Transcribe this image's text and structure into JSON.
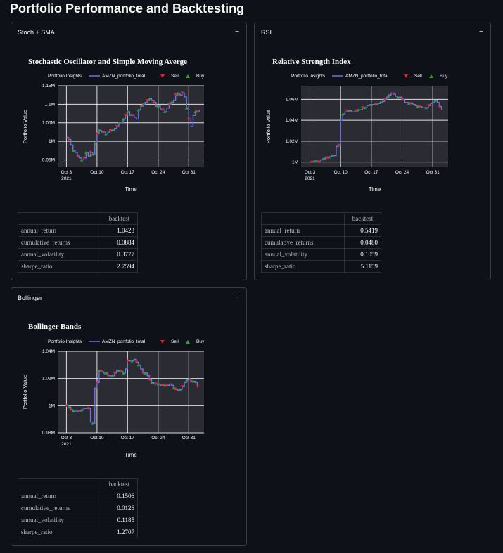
{
  "page": {
    "title": "Portfolio Performance and Backtesting"
  },
  "legend": {
    "label": "Portfolio Insights",
    "series": "AMZN_portfolio_total",
    "sell": "Sell",
    "buy": "Buy"
  },
  "colors": {
    "line": "#6b73e6",
    "sell": "#e0242a",
    "buy": "#2aa12a",
    "bg": "#0e1117",
    "plot_bg": "#2a2b33"
  },
  "panels": {
    "stoch": {
      "header": "Stoch + SMA",
      "collapse": "−",
      "chart_title": "Stochastic Oscillator and Simple Moving Averge",
      "table": {
        "col": "backtest",
        "rows": [
          {
            "key": "annual_return",
            "val": "1.0423"
          },
          {
            "key": "cumulative_returns",
            "val": "0.0884"
          },
          {
            "key": "annual_volatility",
            "val": "0.3777"
          },
          {
            "key": "sharpe_ratio",
            "val": "2.7594"
          }
        ]
      }
    },
    "rsi": {
      "header": "RSI",
      "collapse": "−",
      "chart_title": "Relative Strength Index",
      "table": {
        "col": "backtest",
        "rows": [
          {
            "key": "annual_return",
            "val": "0.5419"
          },
          {
            "key": "cumulative_returns",
            "val": "0.0480"
          },
          {
            "key": "annual_volatility",
            "val": "0.1059"
          },
          {
            "key": "sharpe_ratio",
            "val": "5.1159"
          }
        ]
      }
    },
    "bollinger": {
      "header": "Bollinger",
      "collapse": "−",
      "chart_title": "Bollinger Bands",
      "table": {
        "col": "backtest",
        "rows": [
          {
            "key": "annual_return",
            "val": "0.1506"
          },
          {
            "key": "cumulative_returns",
            "val": "0.0126"
          },
          {
            "key": "annual_volatility",
            "val": "0.1185"
          },
          {
            "key": "sharpe_ratio",
            "val": "1.2707"
          }
        ]
      }
    }
  },
  "chart_data": [
    {
      "type": "line",
      "title": "Stochastic Oscillator and Simple Moving Averge",
      "xlabel": "Time",
      "ylabel": "Portfolio Value",
      "x_ticks": [
        "Oct 3",
        "Oct 10",
        "Oct 17",
        "Oct 24",
        "Oct 31"
      ],
      "x_tick_sub": "2021",
      "y_ticks": [
        "0.95M",
        "1M",
        "1.05M",
        "1.1M",
        "1.15M"
      ],
      "xlim": [
        -2,
        31.5
      ],
      "ylim": [
        0.93,
        1.15
      ],
      "grid": true,
      "legend": "top",
      "series": [
        {
          "name": "AMZN_portfolio_total",
          "x": [
            0,
            0.5,
            1,
            1.5,
            2,
            2.5,
            3,
            3.5,
            4,
            4.5,
            5,
            5.5,
            6,
            6.5,
            7,
            7.5,
            8,
            8.5,
            9,
            9.5,
            10,
            10.5,
            11,
            11.5,
            12,
            12.5,
            13,
            13.5,
            14,
            14.5,
            15,
            15.5,
            16,
            16.5,
            17,
            17.5,
            18,
            18.5,
            19,
            19.5,
            20,
            20.5,
            21,
            21.5,
            22,
            22.5,
            23,
            23.5,
            24,
            24.5,
            25,
            25.5,
            26,
            26.5,
            27,
            27.5,
            28,
            28.5,
            29,
            29.5,
            30,
            30.5
          ],
          "y": [
            1.01,
            1.005,
            0.99,
            0.975,
            0.97,
            0.96,
            0.955,
            0.95,
            0.955,
            0.97,
            0.96,
            0.97,
            0.965,
            0.995,
            1.02,
            1.03,
            1.025,
            1.025,
            1.02,
            1.025,
            1.03,
            1.03,
            1.035,
            1.04,
            1.05,
            1.05,
            1.06,
            1.07,
            1.08,
            1.07,
            1.07,
            1.065,
            1.06,
            1.085,
            1.095,
            1.1,
            1.105,
            1.11,
            1.115,
            1.11,
            1.105,
            1.095,
            1.095,
            1.085,
            1.085,
            1.08,
            1.09,
            1.1,
            1.105,
            1.11,
            1.125,
            1.13,
            1.125,
            1.13,
            1.12,
            1.09,
            1.06,
            1.04,
            1.07,
            1.08,
            1.08,
            1.085
          ]
        }
      ],
      "buys_x": [
        1.5,
        3.5,
        4.5,
        6,
        6.5,
        7.5,
        9,
        10.5,
        12,
        13,
        14,
        16.5,
        17.5,
        19,
        21,
        22.5,
        24,
        25.5,
        27.5,
        29.5
      ],
      "sells_x": [
        0.5,
        2.5,
        4,
        5.5,
        7,
        8.5,
        10,
        11.5,
        13.5,
        15,
        17,
        18.5,
        20,
        22,
        23.5,
        25,
        26.5,
        28,
        30
      ]
    },
    {
      "type": "line",
      "title": "Relative Strength Index",
      "xlabel": "Time",
      "ylabel": "Portfolio Value",
      "x_ticks": [
        "Oct 3",
        "Oct 10",
        "Oct 17",
        "Oct 24",
        "Oct 31"
      ],
      "x_tick_sub": "2021",
      "y_ticks": [
        "1M",
        "1.02M",
        "1.04M",
        "1.06M"
      ],
      "xlim": [
        -2,
        31.5
      ],
      "ylim": [
        0.995,
        1.073
      ],
      "grid": true,
      "legend": "top",
      "series": [
        {
          "name": "AMZN_portfolio_total",
          "x": [
            0,
            0.5,
            1,
            1.5,
            2,
            2.5,
            3,
            3.5,
            4,
            4.5,
            5,
            5.5,
            6,
            6.5,
            7,
            7.5,
            8,
            8.5,
            9,
            9.5,
            10,
            10.5,
            11,
            11.5,
            12,
            12.5,
            13,
            13.5,
            14,
            14.5,
            15,
            15.5,
            16,
            16.5,
            17,
            17.5,
            18,
            18.5,
            19,
            19.5,
            20,
            20.5,
            21,
            21.5,
            22,
            22.5,
            23,
            23.5,
            24,
            24.5,
            25,
            25.5,
            26,
            26.5,
            27,
            27.5,
            28,
            28.5,
            29,
            29.5,
            30
          ],
          "y": [
            1.0,
            1.0,
            1.001,
            1.001,
            1.0,
            1.002,
            1.003,
            1.004,
            1.004,
            1.005,
            1.006,
            1.006,
            1.015,
            1.016,
            1.04,
            1.046,
            1.048,
            1.049,
            1.049,
            1.048,
            1.048,
            1.049,
            1.05,
            1.05,
            1.052,
            1.052,
            1.054,
            1.055,
            1.055,
            1.055,
            1.055,
            1.056,
            1.057,
            1.058,
            1.06,
            1.062,
            1.064,
            1.066,
            1.065,
            1.063,
            1.062,
            1.062,
            1.06,
            1.057,
            1.057,
            1.056,
            1.056,
            1.055,
            1.054,
            1.053,
            1.053,
            1.052,
            1.052,
            1.052,
            1.054,
            1.056,
            1.057,
            1.059,
            1.057,
            1.053,
            1.05
          ]
        }
      ],
      "buys_x": [
        1,
        3,
        5,
        7.5,
        9,
        11,
        12.5,
        14,
        16,
        18,
        20,
        22.5,
        24.5,
        26.5,
        28.5
      ],
      "sells_x": [
        0.5,
        2,
        4,
        6.5,
        8.5,
        10.5,
        12,
        15,
        17,
        19,
        21,
        23,
        25,
        27,
        29.5
      ]
    },
    {
      "type": "line",
      "title": "Bollinger Bands",
      "xlabel": "Time",
      "ylabel": "Portfolio Value",
      "x_ticks": [
        "Oct 3",
        "Oct 10",
        "Oct 17",
        "Oct 24",
        "Oct 31"
      ],
      "x_tick_sub": "2021",
      "y_ticks": [
        "0.98M",
        "1M",
        "1.02M",
        "1.04M"
      ],
      "xlim": [
        -2,
        31.5
      ],
      "ylim": [
        0.98,
        1.04
      ],
      "grid": true,
      "legend": "top",
      "series": [
        {
          "name": "AMZN_portfolio_total",
          "x": [
            0,
            0.5,
            1,
            1.5,
            2,
            2.5,
            3,
            3.5,
            4,
            4.5,
            5,
            5.5,
            6,
            6.5,
            7,
            7.5,
            8,
            8.5,
            9,
            9.5,
            10,
            10.5,
            11,
            11.5,
            12,
            12.5,
            13,
            13.5,
            14,
            14.5,
            15,
            15.5,
            16,
            16.5,
            17,
            17.5,
            18,
            18.5,
            19,
            19.5,
            20,
            20.5,
            21,
            21.5,
            22,
            22.5,
            23,
            23.5,
            24,
            24.5,
            25,
            25.5,
            26,
            26.5,
            27,
            27.5,
            28,
            28.5,
            29,
            29.5,
            30
          ],
          "y": [
            1.0,
            0.999,
            0.997,
            0.996,
            0.996,
            0.996,
            0.996,
            0.997,
            0.998,
            0.998,
            0.998,
            0.988,
            0.987,
            1.013,
            1.017,
            1.026,
            1.025,
            1.024,
            1.024,
            1.022,
            1.022,
            1.022,
            1.024,
            1.026,
            1.026,
            1.025,
            1.024,
            1.027,
            1.033,
            1.033,
            1.033,
            1.034,
            1.032,
            1.03,
            1.027,
            1.024,
            1.024,
            1.022,
            1.019,
            1.017,
            1.016,
            1.016,
            1.016,
            1.015,
            1.015,
            1.015,
            1.015,
            1.016,
            1.015,
            1.013,
            1.012,
            1.011,
            1.012,
            1.014,
            1.017,
            1.019,
            1.02,
            1.018,
            1.018,
            1.017,
            1.014
          ]
        }
      ],
      "buys_x": [
        0.5,
        1.5,
        3.5,
        6,
        7.5,
        9,
        10.5,
        12,
        13,
        15,
        16.5,
        18,
        19.5,
        21,
        22.5,
        24.5,
        26,
        27.5,
        29
      ],
      "sells_x": [
        0,
        1,
        3,
        5,
        7,
        8,
        9.5,
        11,
        12.5,
        14,
        16,
        17.5,
        19,
        20.5,
        22,
        23,
        25,
        26.5,
        28.5,
        30
      ]
    }
  ]
}
